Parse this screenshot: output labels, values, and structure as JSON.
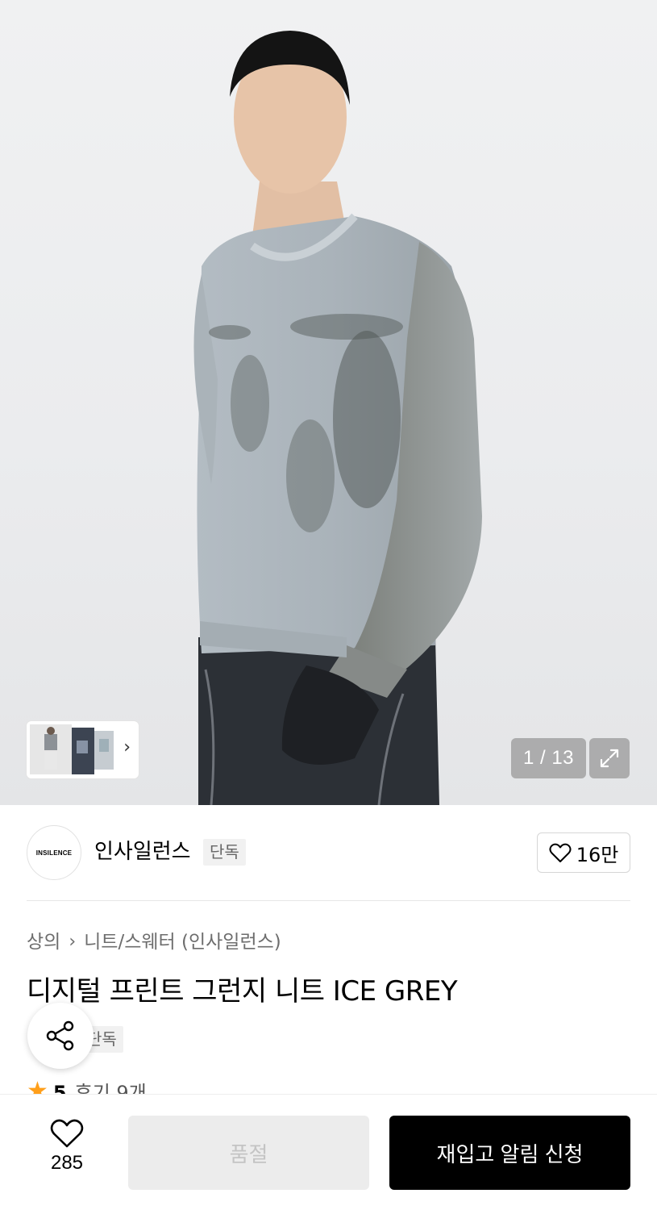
{
  "gallery": {
    "counter": "1 / 13",
    "current_index": 1,
    "total": 13,
    "thumbnail_next_icon": "chevron-right-icon",
    "expand_icon": "expand-icon"
  },
  "brand": {
    "logo_text": "INSILENCE",
    "name": "인사일런스",
    "badge": "단독",
    "likes": "16만",
    "like_icon": "heart-outline-icon"
  },
  "product": {
    "breadcrumb": [
      "상의",
      "니트/스웨터 (인사일런스)"
    ],
    "breadcrumb_separator_icon": "chevron-right-icon",
    "title": "디지털 프린트 그런지 니트 ICE GREY",
    "badge": "단독",
    "rating": {
      "star_icon": "star-icon",
      "score": "5",
      "reviews": "후기 9개"
    },
    "share_icon": "share-icon"
  },
  "bottom_bar": {
    "wish_icon": "heart-outline-icon",
    "wish_count": "285",
    "soldout_label": "품절",
    "restock_label": "재입고 알림 신청"
  },
  "colors": {
    "accent_star": "#ff9f1a",
    "primary_button": "#000000",
    "disabled_button": "#ececec"
  }
}
